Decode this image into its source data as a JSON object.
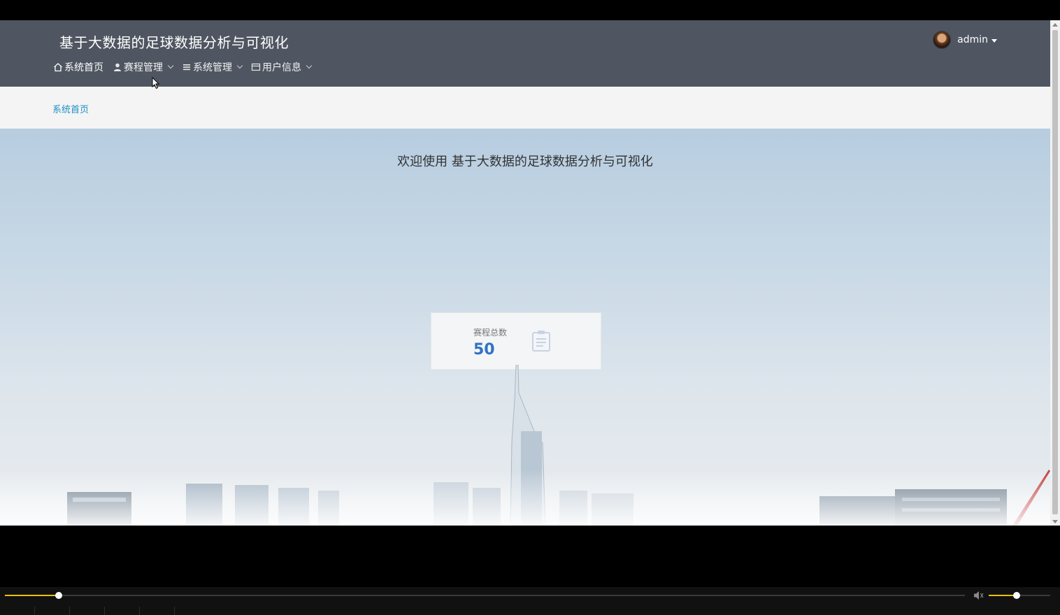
{
  "header": {
    "site_title": "基于大数据的足球数据分析与可视化",
    "nav": [
      {
        "label": "系统首页",
        "icon": "home-icon",
        "has_dropdown": false,
        "active": true
      },
      {
        "label": "赛程管理",
        "icon": "user-icon",
        "has_dropdown": true
      },
      {
        "label": "系统管理",
        "icon": "list-icon",
        "has_dropdown": true
      },
      {
        "label": "用户信息",
        "icon": "card-icon",
        "has_dropdown": true
      }
    ],
    "user": {
      "name": "admin",
      "avatar": "avatar-icon"
    }
  },
  "breadcrumb": {
    "current": "系统首页"
  },
  "main": {
    "welcome_prefix": "欢迎使用 ",
    "welcome_title": "基于大数据的足球数据分析与可视化",
    "stat_card": {
      "label": "赛程总数",
      "value": "50",
      "icon": "clipboard-icon"
    }
  },
  "player": {
    "progress": 0.056,
    "volume": 0.45,
    "icons": [
      "speaker-icon"
    ]
  },
  "colors": {
    "header_bg": "#4f5661",
    "breadcrumb_text": "#1e8fc4",
    "stat_value": "#2f73c5",
    "progress_accent": "#e6c300"
  }
}
